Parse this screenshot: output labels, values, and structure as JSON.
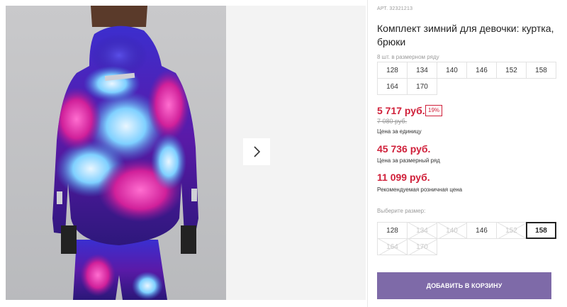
{
  "product": {
    "article": "АРТ. 32321213",
    "title": "Комплект зимний для девочки: куртка, брюки",
    "image_description_icon": "product-photo",
    "next_icon": "chevron-right-icon"
  },
  "sizes_in_row": {
    "note": "8 шт. в размерном ряду",
    "sizes": [
      "128",
      "134",
      "140",
      "146",
      "152",
      "158",
      "164",
      "170"
    ]
  },
  "prices": {
    "unit_price": "5 717 руб.",
    "discount": "19%",
    "old_price": "7 080 руб.",
    "unit_label": "Цена за единицу",
    "row_price": "45 736 руб.",
    "row_label": "Цена за размерный ряд",
    "rrp_price": "11 099 руб.",
    "rrp_label": "Рекомендуемая розничная цена"
  },
  "size_picker": {
    "label": "Выберите размер:",
    "options": [
      {
        "label": "128",
        "available": true,
        "selected": false
      },
      {
        "label": "134",
        "available": false,
        "selected": false
      },
      {
        "label": "140",
        "available": false,
        "selected": false
      },
      {
        "label": "146",
        "available": true,
        "selected": false
      },
      {
        "label": "152",
        "available": false,
        "selected": false
      },
      {
        "label": "158",
        "available": true,
        "selected": true
      },
      {
        "label": "164",
        "available": false,
        "selected": false
      },
      {
        "label": "170",
        "available": false,
        "selected": false
      }
    ]
  },
  "cart": {
    "add_label": "ДОБАВИТЬ В КОРЗИНУ"
  },
  "colors": {
    "price_red": "#d0203a",
    "button_purple": "#7e6aa8"
  }
}
